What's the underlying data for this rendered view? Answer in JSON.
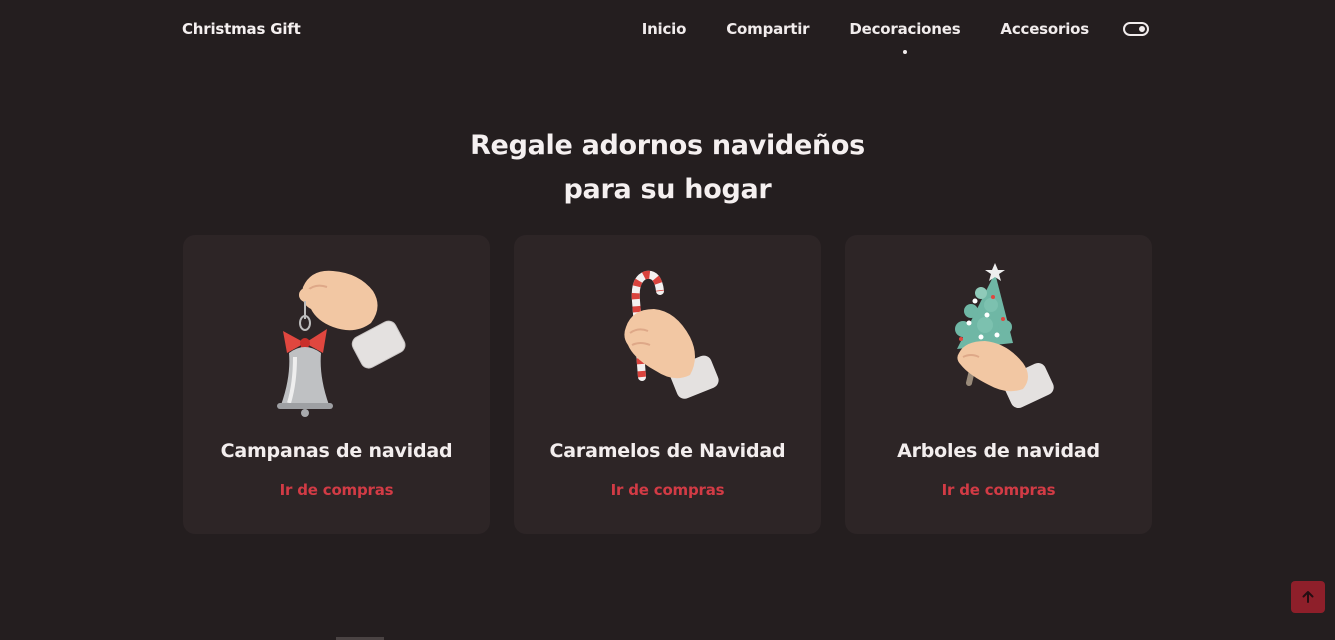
{
  "header": {
    "logo": "Christmas Gift",
    "nav": [
      "Inicio",
      "Compartir",
      "Decoraciones",
      "Accesorios"
    ],
    "active_nav": "Decoraciones",
    "theme_toggle_icon": "toggle-switch-icon"
  },
  "section": {
    "title_line1": "Regale adornos navideños",
    "title_line2": "para su hogar"
  },
  "cards": [
    {
      "title": "Campanas de navidad",
      "link": "Ir de compras",
      "image_icon": "hand-holding-bell-icon"
    },
    {
      "title": "Caramelos de Navidad",
      "link": "Ir de compras",
      "image_icon": "hand-holding-candy-cane-icon"
    },
    {
      "title": "Arboles de navidad",
      "link": "Ir de compras",
      "image_icon": "hand-holding-tree-icon"
    }
  ],
  "scroll_up_icon": "arrow-up-icon",
  "colors": {
    "background": "#241e1f",
    "card": "#2d2526",
    "accent": "#d23b45",
    "scroll_button": "#8e1f2a"
  }
}
